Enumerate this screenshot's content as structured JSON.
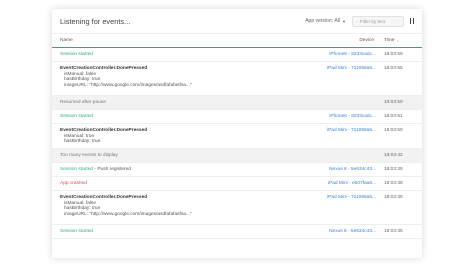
{
  "header": {
    "title": "Listening for events...",
    "version_label": "App version:",
    "version_value": "All",
    "search_placeholder": "Filter by text"
  },
  "columns": {
    "name": "Name",
    "device": "Device",
    "time": "Time"
  },
  "rows": [
    {
      "text": "Session started",
      "device": "iPhone6 - 8233cadc...",
      "time": "18:03:56"
    },
    {
      "title": "EventCreationController.DonePressed",
      "attrs": [
        "isManual: false",
        "hasBirthday: true",
        "imageURL: \"http://www.google.com/images/asdfafafasfsa...\""
      ],
      "device": "iPad Mini - 711058a5...",
      "time": "18:03:55"
    },
    {
      "text": "Resumed after pause",
      "time": "18:03:50"
    },
    {
      "text": "Session started",
      "device": "iPhone6 - 8233cadc...",
      "time": "18:03:51"
    },
    {
      "title": "EventCreationController.DonePressed",
      "attrs": [
        "isManual: true",
        "hasBirthday: true"
      ],
      "device": "iPad Mini - 711058a5...",
      "time": "18:03:50"
    },
    {
      "text": "Too many events to display",
      "time": "18:03:42"
    },
    {
      "text": "Session started",
      "suffix": " - Push registered",
      "device": "Nexus 6 - 5e634c43...",
      "time": "18:03:39"
    },
    {
      "text": "App crashed",
      "device": "iPad Mini - eb07faa8...",
      "time": "18:03:38"
    },
    {
      "title": "EventCreationController.DonePressed",
      "attrs": [
        "isManual: false",
        "hasBirthday: true",
        "imageURL: \"http://www.google.com/images/asdfafafasfsa...\""
      ],
      "device": "iPad Mini - 711058a5...",
      "time": "18:03:38"
    },
    {
      "text": "Session started",
      "device": "Nexus 6 - 5e634c43...",
      "time": "18:03:35"
    }
  ]
}
